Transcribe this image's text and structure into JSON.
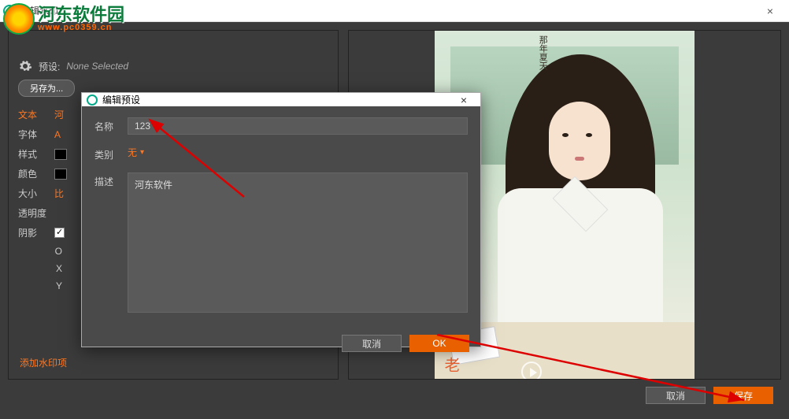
{
  "window": {
    "title": "编辑水印"
  },
  "logo": {
    "name": "河东软件园",
    "url": "www.pc0359.cn"
  },
  "preset": {
    "label": "预设:",
    "value": "None Selected",
    "save_as": "另存为..."
  },
  "form": {
    "text_label": "文本",
    "text_value": "河",
    "font_label": "字体",
    "font_value": "A",
    "style_label": "样式",
    "color_label": "颜色",
    "size_label": "大小",
    "size_value": "比",
    "opacity_label": "透明度",
    "shadow_label": "阴影",
    "o_label": "O",
    "x_label": "X",
    "y_label": "Y"
  },
  "add_watermark": "添加水印项",
  "footer": {
    "cancel": "取消",
    "save": "保存"
  },
  "modal": {
    "title": "编辑预设",
    "name_label": "名称",
    "name_value": "123",
    "category_label": "类别",
    "category_value": "无",
    "desc_label": "描述",
    "desc_value": "河东软件",
    "cancel": "取消",
    "ok": "OK"
  },
  "preview": {
    "top_text": "那年夏天",
    "side_text": "时光不老"
  }
}
